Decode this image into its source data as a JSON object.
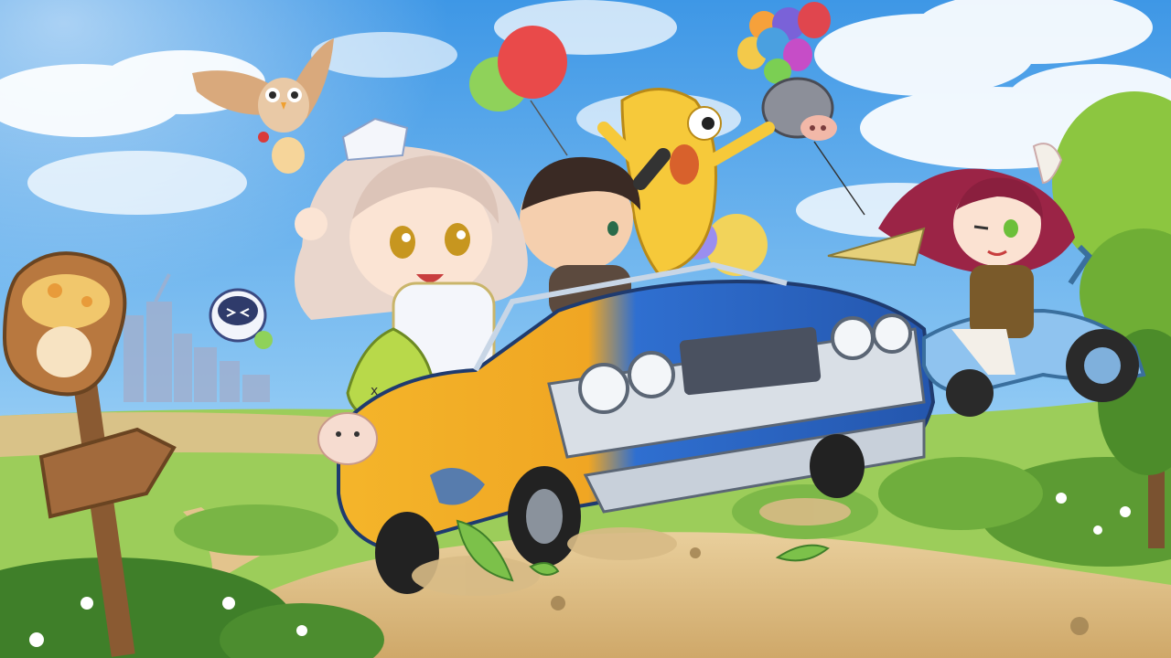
{
  "scene": {
    "kind": "game-key-art",
    "description_visible_text": "",
    "palette": {
      "sky_top": "#3e97e6",
      "sky_bottom": "#a9d9f7",
      "cloud": "#ffffff",
      "grass": "#8cc24a",
      "grass_dark": "#4f8f2c",
      "dirt": "#e3c48d",
      "car_blue": "#2f6fd0",
      "car_yellow": "#f4b52a",
      "chrome": "#d9dfe6",
      "scooter": "#8fc3ef",
      "owl": "#e2b995",
      "yellow_creature": "#f6c93a",
      "slime_green": "#b8d94a",
      "wood": "#a26a3c",
      "mushroom": "#f1c76c"
    },
    "icons": [
      "owl-icon",
      "balloon-icon",
      "mushroom-signpost-icon",
      "pig-robot-icon",
      "ghost-icon"
    ]
  }
}
